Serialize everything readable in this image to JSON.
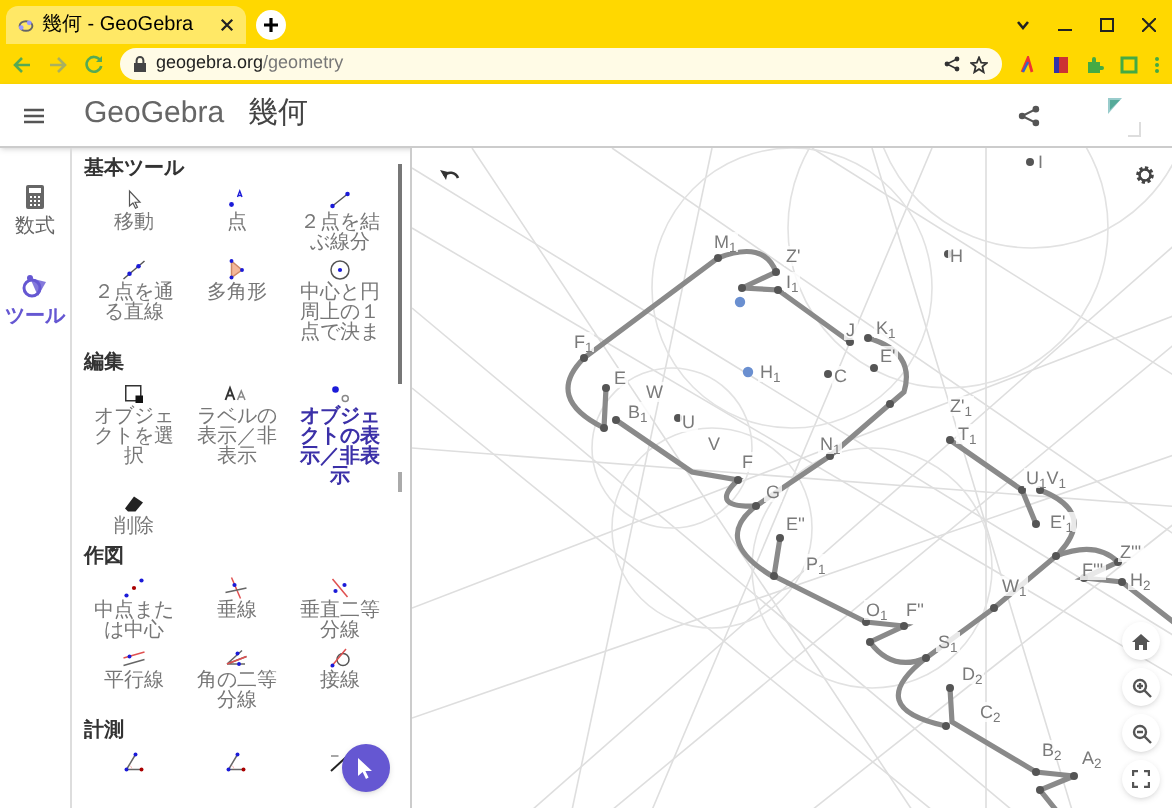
{
  "browser": {
    "tab": {
      "title": "幾何 - GeoGebra",
      "selected": true
    },
    "address": {
      "host": "geogebra.org",
      "path": "/geometry"
    }
  },
  "app_bar": {
    "logo": "GeoGebra",
    "title": "幾何"
  },
  "rail": [
    {
      "label": "数式",
      "kind": "calculator",
      "selected": false
    },
    {
      "label": "ツール",
      "kind": "tools",
      "selected": true
    }
  ],
  "tool_sections": [
    {
      "title": "基本ツール",
      "tools": [
        {
          "label": "移動",
          "kind": "move",
          "selected": false
        },
        {
          "label": "点",
          "kind": "point",
          "selected": false
        },
        {
          "label": "２点を結ぶ線分",
          "kind": "segment",
          "selected": false
        },
        {
          "label": "２点を通る直線",
          "kind": "line",
          "selected": false
        },
        {
          "label": "多角形",
          "kind": "polygon",
          "selected": false
        },
        {
          "label": "中心と円周上の１点で決ま",
          "kind": "circle",
          "selected": false
        }
      ]
    },
    {
      "title": "編集",
      "tools": [
        {
          "label": "オブジェクトを選択",
          "kind": "select",
          "selected": false
        },
        {
          "label": "ラベルの表示／非表示",
          "kind": "label",
          "selected": false
        },
        {
          "label": "オブジェクトの表示／非表示",
          "kind": "showhide",
          "selected": true
        },
        {
          "label": "削除",
          "kind": "eraser",
          "selected": false
        }
      ]
    },
    {
      "title": "作図",
      "tools": [
        {
          "label": "中点または中心",
          "kind": "midpoint",
          "selected": false
        },
        {
          "label": "垂線",
          "kind": "perpendicular",
          "selected": false
        },
        {
          "label": "垂直二等分線",
          "kind": "bisector",
          "selected": false
        },
        {
          "label": "平行線",
          "kind": "parallel",
          "selected": false
        },
        {
          "label": "角の二等分線",
          "kind": "anglebisector",
          "selected": false
        },
        {
          "label": "接線",
          "kind": "tangent",
          "selected": false
        }
      ]
    },
    {
      "title": "計測",
      "tools": [
        {
          "kind": "angle"
        },
        {
          "kind": "angle"
        },
        {
          "kind": "distance"
        }
      ]
    }
  ],
  "canvas": {
    "labels": [
      "I",
      "M$_{1}$",
      "Z'",
      "H",
      "I$_{1}$",
      "J",
      "K$_{1}$",
      "F$_{1}$",
      "E'",
      "E",
      "H$_{1}$",
      "C",
      "W",
      "B$_{1}$",
      "Z'$_{1}$",
      "U",
      "T$_{1}$",
      "V",
      "N$_{1}$",
      "F",
      "U$_{1}$V$_{1}$",
      "G",
      "E''",
      "E'$_{1}$",
      "P$_{1}$",
      "Z'''",
      "F'''",
      "H$_{2}$",
      "W$_{1}$",
      "O$_{1}$",
      "F''",
      "S$_{1}$",
      "D$_{2}$",
      "C$_{2}$",
      "B$_{2}$",
      "A$_{2}$"
    ]
  }
}
